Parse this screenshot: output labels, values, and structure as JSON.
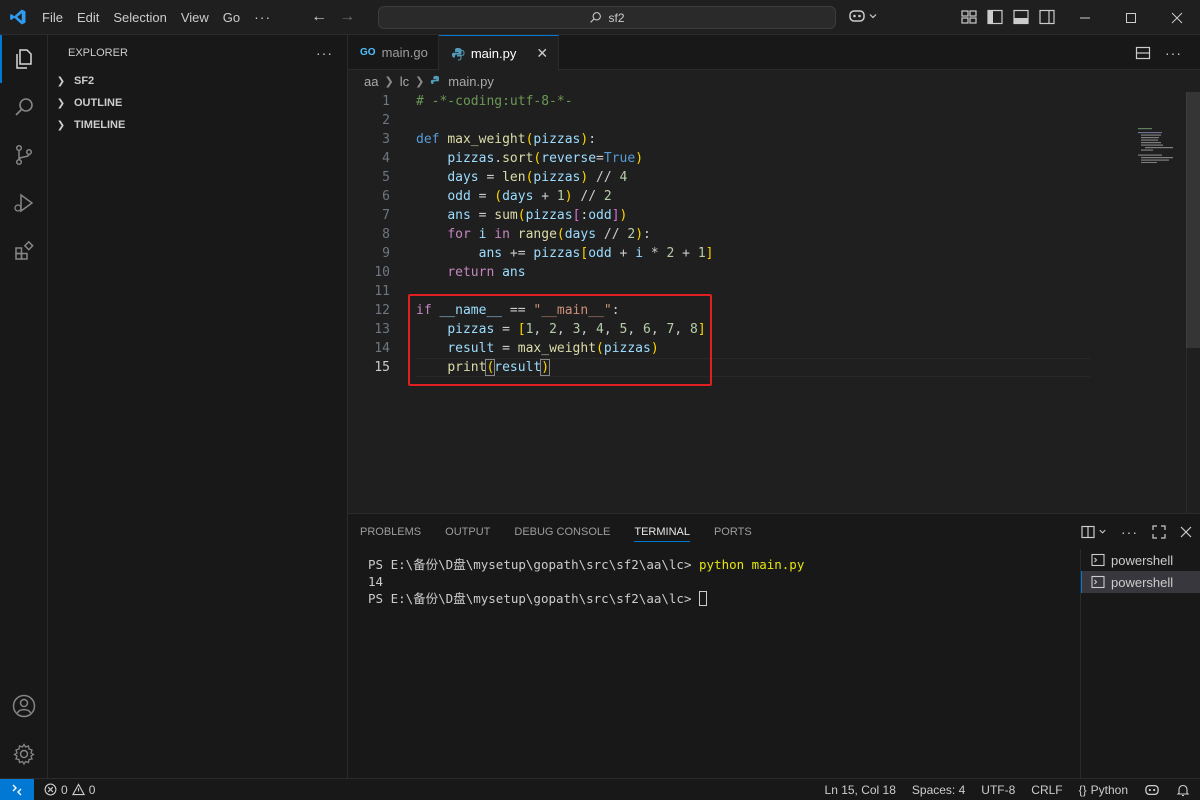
{
  "menu": [
    "File",
    "Edit",
    "Selection",
    "View",
    "Go",
    "···"
  ],
  "search": {
    "text": "sf2"
  },
  "sidebar": {
    "title": "EXPLORER",
    "more": "···",
    "sections": [
      "SF2",
      "OUTLINE",
      "TIMELINE"
    ]
  },
  "tabs": [
    {
      "badge": "GO",
      "label": "main.go"
    },
    {
      "label": "main.py",
      "close": "✕"
    }
  ],
  "breadcrumb": [
    "aa",
    "lc",
    "main.py"
  ],
  "code": {
    "line_numbers": [
      "1",
      "2",
      "3",
      "4",
      "5",
      "6",
      "7",
      "8",
      "9",
      "10",
      "11",
      "12",
      "13",
      "14",
      "15"
    ],
    "current_line": "15"
  },
  "panel": {
    "tabs": [
      "PROBLEMS",
      "OUTPUT",
      "DEBUG CONSOLE",
      "TERMINAL",
      "PORTS"
    ],
    "active_tab": "TERMINAL",
    "terminal": {
      "prompt1": "PS E:\\备份\\D盘\\mysetup\\gopath\\src\\sf2\\aa\\lc> ",
      "command": "python main.py",
      "output": "14",
      "prompt2": "PS E:\\备份\\D盘\\mysetup\\gopath\\src\\sf2\\aa\\lc> "
    },
    "terminal_list": [
      "powershell",
      "powershell"
    ]
  },
  "status": {
    "errors": "0",
    "warnings": "0",
    "position": "Ln 15, Col 18",
    "spaces": "Spaces: 4",
    "encoding": "UTF-8",
    "eol": "CRLF",
    "language": "Python",
    "language_braces": "{}"
  },
  "colors": {
    "accent": "#0078d4",
    "highlight_box": "#e02020"
  }
}
